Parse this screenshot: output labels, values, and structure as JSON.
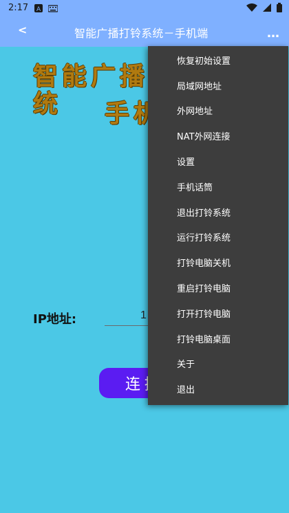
{
  "status": {
    "time": "2:17",
    "icons": [
      "a-icon",
      "keyboard-icon",
      "wifi-icon",
      "signal-icon",
      "battery-icon"
    ]
  },
  "app_bar": {
    "back_label": "<",
    "title": "智能广播打铃系统－手机端",
    "more_label": "…"
  },
  "headline": {
    "line1": "智能广播打铃系统",
    "line2": "手机端"
  },
  "form": {
    "ip_label": "IP地址:",
    "ip_value": "1",
    "connect_label": "连接"
  },
  "menu": {
    "items": [
      "恢复初始设置",
      "局域网地址",
      "外网地址",
      "NAT外网连接",
      "设置",
      "手机话筒",
      "退出打铃系统",
      "运行打铃系统",
      "打铃电脑关机",
      "重启打铃电脑",
      "打开打铃电脑",
      "打铃电脑桌面",
      "关于",
      "退出"
    ]
  },
  "colors": {
    "status_bar": "#7fb0ff",
    "background": "#4bc8e6",
    "menu_bg": "#3d3d3d",
    "button": "#5b1cf2",
    "headline": "#b07a10"
  }
}
